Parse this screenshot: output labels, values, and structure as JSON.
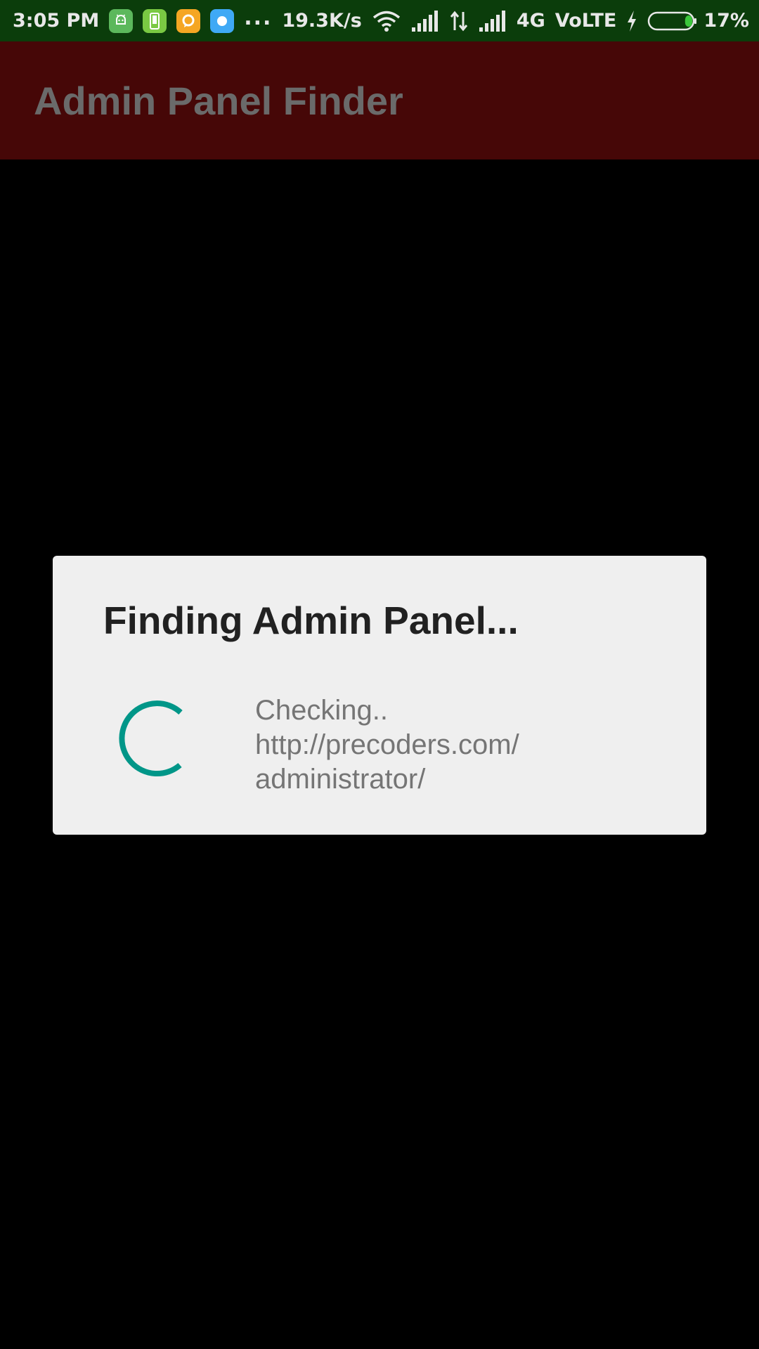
{
  "status_bar": {
    "time": "3:05 PM",
    "more_indicator": "...",
    "network_speed": "19.3K/s",
    "network_type": "4G",
    "volte": "VoLTE",
    "battery_percent": "17%",
    "battery_level": 17,
    "colors": {
      "background": "#0b3d0b",
      "text": "#e8e8e8"
    },
    "notification_icons": [
      {
        "name": "android-robot-icon",
        "color": "#5cb85c"
      },
      {
        "name": "phone-icon",
        "color": "#7ac943"
      },
      {
        "name": "chat-bubble-icon",
        "color": "#f5a623"
      },
      {
        "name": "chat-bubble-icon",
        "color": "#3fa9f5"
      }
    ]
  },
  "app_bar": {
    "title": "Admin Panel Finder",
    "background": "#460707",
    "title_color": "#6a6a6a"
  },
  "dialog": {
    "title": "Finding Admin Panel...",
    "message": "Checking..\nhttp://precoders.com/\nadministrator/",
    "spinner_color": "#009688",
    "background": "#efefef"
  }
}
